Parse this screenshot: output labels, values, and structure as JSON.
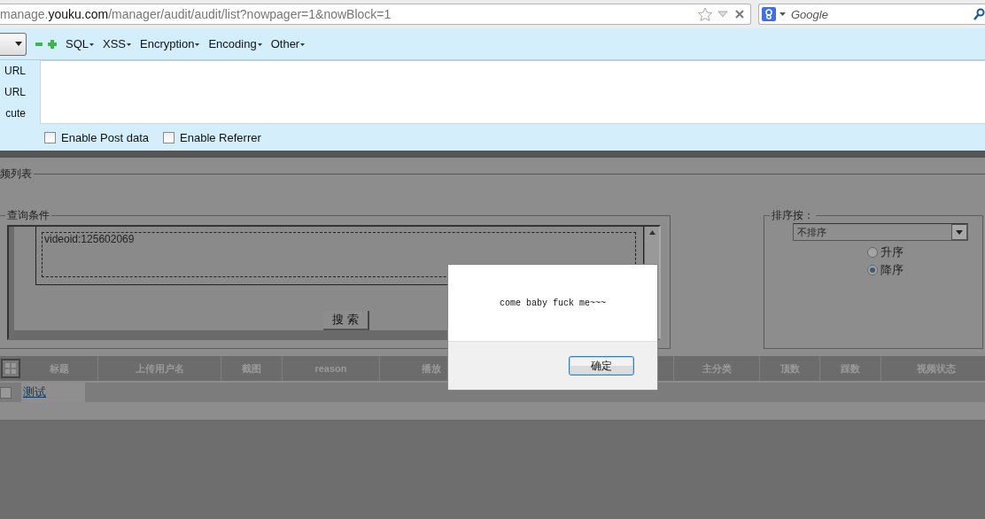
{
  "browser": {
    "url": {
      "prefix": "manage.",
      "domain": "youku.com",
      "path": "/manager/audit/audit/list?nowpager=1&nowBlock=1"
    },
    "search": {
      "placeholder": "Google"
    }
  },
  "hackbar": {
    "menus": [
      "SQL",
      "XSS",
      "Encryption",
      "Encoding",
      "Other"
    ],
    "actions": [
      {
        "label": "URL"
      },
      {
        "label": "URL"
      },
      {
        "label": "cute"
      }
    ],
    "options": [
      {
        "label": "Enable Post data",
        "checked": false
      },
      {
        "label": "Enable Referrer",
        "checked": false
      }
    ]
  },
  "page": {
    "title": "频列表",
    "query": {
      "legend": "查询条件",
      "value": "videoid:125602069",
      "button": "搜 索"
    },
    "sort": {
      "legend": "排序按：",
      "select": "不排序",
      "orders": [
        {
          "label": "升序",
          "selected": false
        },
        {
          "label": "降序",
          "selected": true
        }
      ]
    },
    "table": {
      "columns": [
        "标题",
        "上传用户名",
        "截图",
        "reason",
        "播放",
        "",
        "主分类",
        "顶数",
        "踩数",
        "视频状态"
      ],
      "rows": [
        {
          "checked": false,
          "title": "测试"
        }
      ]
    }
  },
  "alert": {
    "message": "come baby fuck me~~~",
    "button": "确定"
  }
}
